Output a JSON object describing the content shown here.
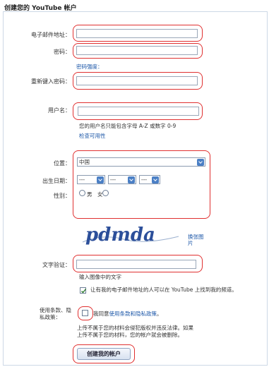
{
  "page": {
    "title": "创建您的 YouTube 帐户"
  },
  "form": {
    "email_label": "电子邮件地址：",
    "password_label": "密码：",
    "password_strength_link": "密码强度：",
    "password_confirm_label": "重新键入密码：",
    "username_label": "用户名：",
    "username_hint": "您的用户名只能包含字母 A-Z 或数字 0-9",
    "check_availability_link": "检查可用性",
    "location_label": "位置：",
    "location_value": "中国",
    "birthdate_label": "出生日期：",
    "birth_month": "---",
    "birth_day": "---",
    "birth_year": "---",
    "gender_label": "性别：",
    "gender_male": "男",
    "gender_female": "女",
    "captcha_text": "pdmda",
    "change_image_link": "换张图片",
    "word_verify_label": "文字验证：",
    "word_verify_hint": "输入图像中的文字",
    "allow_find_text": "让有我的电子邮件地址的人可以在 YouTube 上找到我的频道。",
    "terms_label": "使用条款、隐私政策：",
    "terms_agree_prefix": "我同意",
    "terms_link": "使用条款和隐私政策",
    "terms_agree_suffix": "。",
    "terms_warning": "上传不属于您的材料会侵犯版权并违反法律。如果上传不属于您的材料，您的帐户就会被删除。",
    "create_button": "创建我的帐户"
  },
  "colors": {
    "highlight": "#e03030",
    "link": "#1c57a8"
  }
}
